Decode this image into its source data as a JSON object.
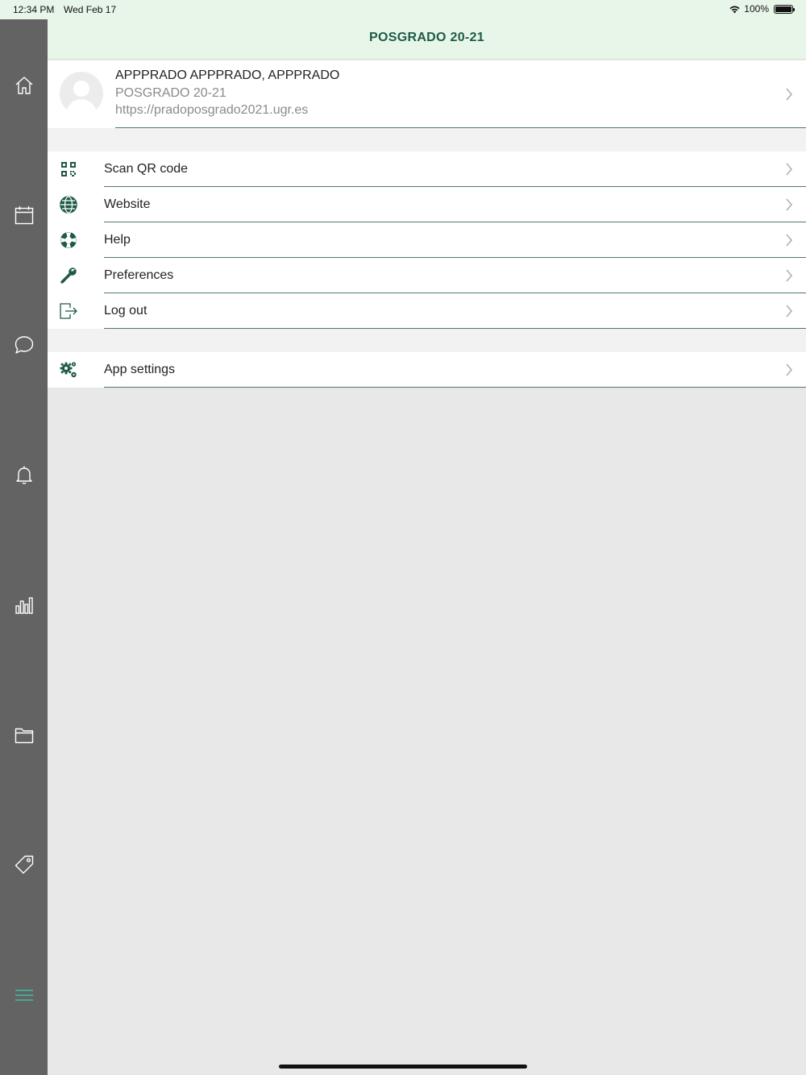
{
  "status": {
    "time": "12:34 PM",
    "date": "Wed Feb 17",
    "battery": "100%"
  },
  "header": {
    "title": "POSGRADO 20-21"
  },
  "sidebar": {
    "items": [
      {
        "icon": "home-icon"
      },
      {
        "icon": "calendar-icon"
      },
      {
        "icon": "chat-bubble-icon"
      },
      {
        "icon": "bell-icon"
      },
      {
        "icon": "bar-chart-icon"
      },
      {
        "icon": "folder-icon"
      },
      {
        "icon": "tag-icon"
      },
      {
        "icon": "menu-icon",
        "active": true
      }
    ]
  },
  "profile": {
    "name": "APPPRADO APPPRADO, APPPRADO",
    "site": "POSGRADO 20-21",
    "url": "https://pradoposgrado2021.ugr.es"
  },
  "menu": {
    "items": [
      {
        "label": "Scan QR code",
        "icon": "qr-code-icon"
      },
      {
        "label": "Website",
        "icon": "globe-icon"
      },
      {
        "label": "Help",
        "icon": "life-ring-icon"
      },
      {
        "label": "Preferences",
        "icon": "wrench-icon"
      },
      {
        "label": "Log out",
        "icon": "logout-icon"
      }
    ],
    "settings": {
      "label": "App settings",
      "icon": "gears-icon"
    }
  },
  "colors": {
    "accent": "#1e5b48",
    "header_bg": "#e8f5e9",
    "sidebar_bg": "#636363",
    "active_icon": "#3fbf9f"
  }
}
